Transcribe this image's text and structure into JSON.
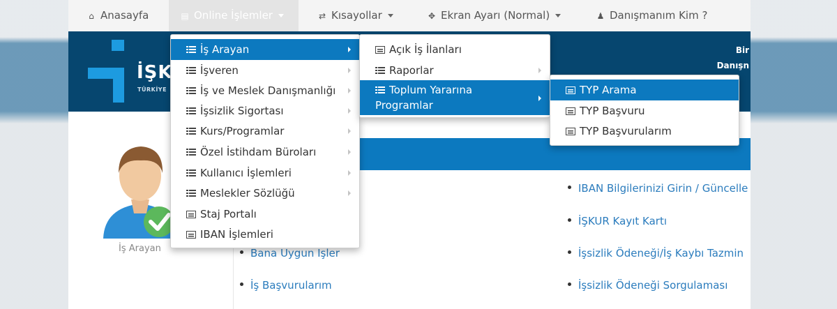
{
  "topnav": {
    "home": "Anasayfa",
    "online": "Online İşlemler",
    "shortcuts": "Kısayollar",
    "screen": "Ekran Ayarı (Normal)",
    "advisor": "Danışmanım Kim ?"
  },
  "header": {
    "logo_text": "İŞK",
    "logo_sub": "TÜRKİYE",
    "right_line1": "Bir",
    "right_line2": "Danışn"
  },
  "menu1": {
    "items": [
      {
        "label": "İş Arayan"
      },
      {
        "label": "İşveren"
      },
      {
        "label": "İş ve Meslek Danışmanlığı"
      },
      {
        "label": "İşsizlik Sigortası"
      },
      {
        "label": "Kurs/Programlar"
      },
      {
        "label": "Özel İstihdam Büroları"
      },
      {
        "label": "Kullanıcı İşlemleri"
      },
      {
        "label": "Meslekler Sözlüğü"
      },
      {
        "label": "Staj Portalı"
      },
      {
        "label": "IBAN İşlemleri"
      }
    ]
  },
  "menu2": {
    "items": [
      {
        "label": "Açık İş İlanları"
      },
      {
        "label": "Raporlar"
      },
      {
        "label_line1": "Toplum Yararına",
        "label_line2": "Programlar"
      }
    ]
  },
  "menu3": {
    "items": [
      {
        "label": "TYP Arama"
      },
      {
        "label": "TYP Başvuru"
      },
      {
        "label": "TYP Başvurularım"
      }
    ]
  },
  "profile": {
    "label": "İş Arayan"
  },
  "left_links": [
    "Bana Uygun İşler",
    "İş Başvurularım"
  ],
  "right_links": [
    "IBAN Bilgilerinizi Girin / Güncelle",
    "İŞKUR Kayıt Kartı",
    "İşsizlik Ödeneği/İş Kaybı Tazmin",
    "İşsizlik Ödeneği Sorgulaması"
  ],
  "colors": {
    "header_band": "#06466f",
    "accent_blue": "#0c79bf",
    "link": "#2b7cbd"
  }
}
